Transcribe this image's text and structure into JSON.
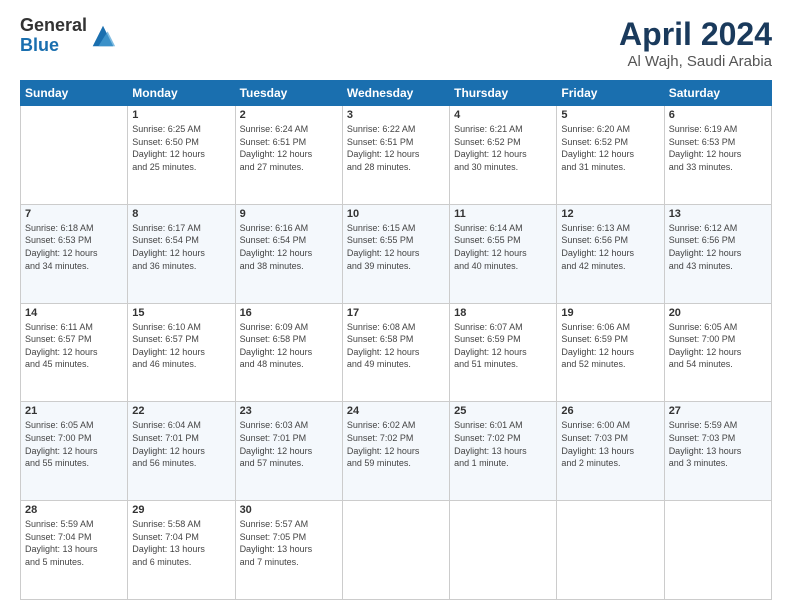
{
  "header": {
    "logo_general": "General",
    "logo_blue": "Blue",
    "month_title": "April 2024",
    "location": "Al Wajh, Saudi Arabia"
  },
  "weekdays": [
    "Sunday",
    "Monday",
    "Tuesday",
    "Wednesday",
    "Thursday",
    "Friday",
    "Saturday"
  ],
  "weeks": [
    [
      {
        "day": "",
        "info": ""
      },
      {
        "day": "1",
        "info": "Sunrise: 6:25 AM\nSunset: 6:50 PM\nDaylight: 12 hours\nand 25 minutes."
      },
      {
        "day": "2",
        "info": "Sunrise: 6:24 AM\nSunset: 6:51 PM\nDaylight: 12 hours\nand 27 minutes."
      },
      {
        "day": "3",
        "info": "Sunrise: 6:22 AM\nSunset: 6:51 PM\nDaylight: 12 hours\nand 28 minutes."
      },
      {
        "day": "4",
        "info": "Sunrise: 6:21 AM\nSunset: 6:52 PM\nDaylight: 12 hours\nand 30 minutes."
      },
      {
        "day": "5",
        "info": "Sunrise: 6:20 AM\nSunset: 6:52 PM\nDaylight: 12 hours\nand 31 minutes."
      },
      {
        "day": "6",
        "info": "Sunrise: 6:19 AM\nSunset: 6:53 PM\nDaylight: 12 hours\nand 33 minutes."
      }
    ],
    [
      {
        "day": "7",
        "info": "Sunrise: 6:18 AM\nSunset: 6:53 PM\nDaylight: 12 hours\nand 34 minutes."
      },
      {
        "day": "8",
        "info": "Sunrise: 6:17 AM\nSunset: 6:54 PM\nDaylight: 12 hours\nand 36 minutes."
      },
      {
        "day": "9",
        "info": "Sunrise: 6:16 AM\nSunset: 6:54 PM\nDaylight: 12 hours\nand 38 minutes."
      },
      {
        "day": "10",
        "info": "Sunrise: 6:15 AM\nSunset: 6:55 PM\nDaylight: 12 hours\nand 39 minutes."
      },
      {
        "day": "11",
        "info": "Sunrise: 6:14 AM\nSunset: 6:55 PM\nDaylight: 12 hours\nand 40 minutes."
      },
      {
        "day": "12",
        "info": "Sunrise: 6:13 AM\nSunset: 6:56 PM\nDaylight: 12 hours\nand 42 minutes."
      },
      {
        "day": "13",
        "info": "Sunrise: 6:12 AM\nSunset: 6:56 PM\nDaylight: 12 hours\nand 43 minutes."
      }
    ],
    [
      {
        "day": "14",
        "info": "Sunrise: 6:11 AM\nSunset: 6:57 PM\nDaylight: 12 hours\nand 45 minutes."
      },
      {
        "day": "15",
        "info": "Sunrise: 6:10 AM\nSunset: 6:57 PM\nDaylight: 12 hours\nand 46 minutes."
      },
      {
        "day": "16",
        "info": "Sunrise: 6:09 AM\nSunset: 6:58 PM\nDaylight: 12 hours\nand 48 minutes."
      },
      {
        "day": "17",
        "info": "Sunrise: 6:08 AM\nSunset: 6:58 PM\nDaylight: 12 hours\nand 49 minutes."
      },
      {
        "day": "18",
        "info": "Sunrise: 6:07 AM\nSunset: 6:59 PM\nDaylight: 12 hours\nand 51 minutes."
      },
      {
        "day": "19",
        "info": "Sunrise: 6:06 AM\nSunset: 6:59 PM\nDaylight: 12 hours\nand 52 minutes."
      },
      {
        "day": "20",
        "info": "Sunrise: 6:05 AM\nSunset: 7:00 PM\nDaylight: 12 hours\nand 54 minutes."
      }
    ],
    [
      {
        "day": "21",
        "info": "Sunrise: 6:05 AM\nSunset: 7:00 PM\nDaylight: 12 hours\nand 55 minutes."
      },
      {
        "day": "22",
        "info": "Sunrise: 6:04 AM\nSunset: 7:01 PM\nDaylight: 12 hours\nand 56 minutes."
      },
      {
        "day": "23",
        "info": "Sunrise: 6:03 AM\nSunset: 7:01 PM\nDaylight: 12 hours\nand 57 minutes."
      },
      {
        "day": "24",
        "info": "Sunrise: 6:02 AM\nSunset: 7:02 PM\nDaylight: 12 hours\nand 59 minutes."
      },
      {
        "day": "25",
        "info": "Sunrise: 6:01 AM\nSunset: 7:02 PM\nDaylight: 13 hours\nand 1 minute."
      },
      {
        "day": "26",
        "info": "Sunrise: 6:00 AM\nSunset: 7:03 PM\nDaylight: 13 hours\nand 2 minutes."
      },
      {
        "day": "27",
        "info": "Sunrise: 5:59 AM\nSunset: 7:03 PM\nDaylight: 13 hours\nand 3 minutes."
      }
    ],
    [
      {
        "day": "28",
        "info": "Sunrise: 5:59 AM\nSunset: 7:04 PM\nDaylight: 13 hours\nand 5 minutes."
      },
      {
        "day": "29",
        "info": "Sunrise: 5:58 AM\nSunset: 7:04 PM\nDaylight: 13 hours\nand 6 minutes."
      },
      {
        "day": "30",
        "info": "Sunrise: 5:57 AM\nSunset: 7:05 PM\nDaylight: 13 hours\nand 7 minutes."
      },
      {
        "day": "",
        "info": ""
      },
      {
        "day": "",
        "info": ""
      },
      {
        "day": "",
        "info": ""
      },
      {
        "day": "",
        "info": ""
      }
    ]
  ]
}
